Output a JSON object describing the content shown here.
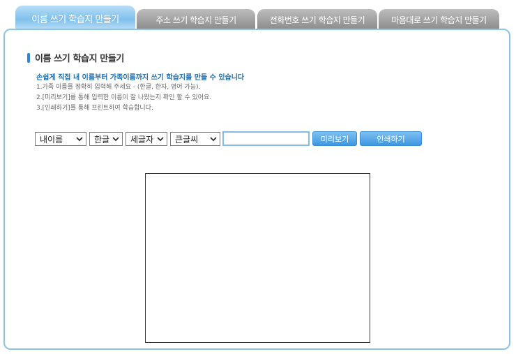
{
  "tabs": [
    {
      "label": "이름 쓰기 학습지 만들기",
      "active": true
    },
    {
      "label": "주소 쓰기 학습지 만들기",
      "active": false
    },
    {
      "label": "전화번호 쓰기 학습지 만들기",
      "active": false
    },
    {
      "label": "마음대로 쓰기 학습지 만들기",
      "active": false
    }
  ],
  "main": {
    "heading": "이름 쓰기 학습지 만들기",
    "intro": "손쉽게 직접 내 이름부터 가족이름까지 쓰기 학습지를 만들 수 있습니다",
    "steps": [
      "1.가족 이름를 정확히 입력해 주세요 - (한글, 한자, 영어 가능).",
      "2.[미리보기]를 통해 입력한 이름이 잘 나왔는지 확인 할 수 있어요.",
      "3.[인쇄하기]를 통해 프린트하여 학습합니다."
    ]
  },
  "controls": {
    "who_select": "내이름",
    "script_select": "한글",
    "orientation_select": "세글자",
    "size_select": "큰글씨",
    "name_value": "",
    "preview_label": "미리보기",
    "print_label": "인쇄하기"
  },
  "colors": {
    "accent": "#2f86d2",
    "tab_active": "#7fc0ec",
    "tab_inactive": "#9a9a9a",
    "button": "#4a9fe3"
  }
}
